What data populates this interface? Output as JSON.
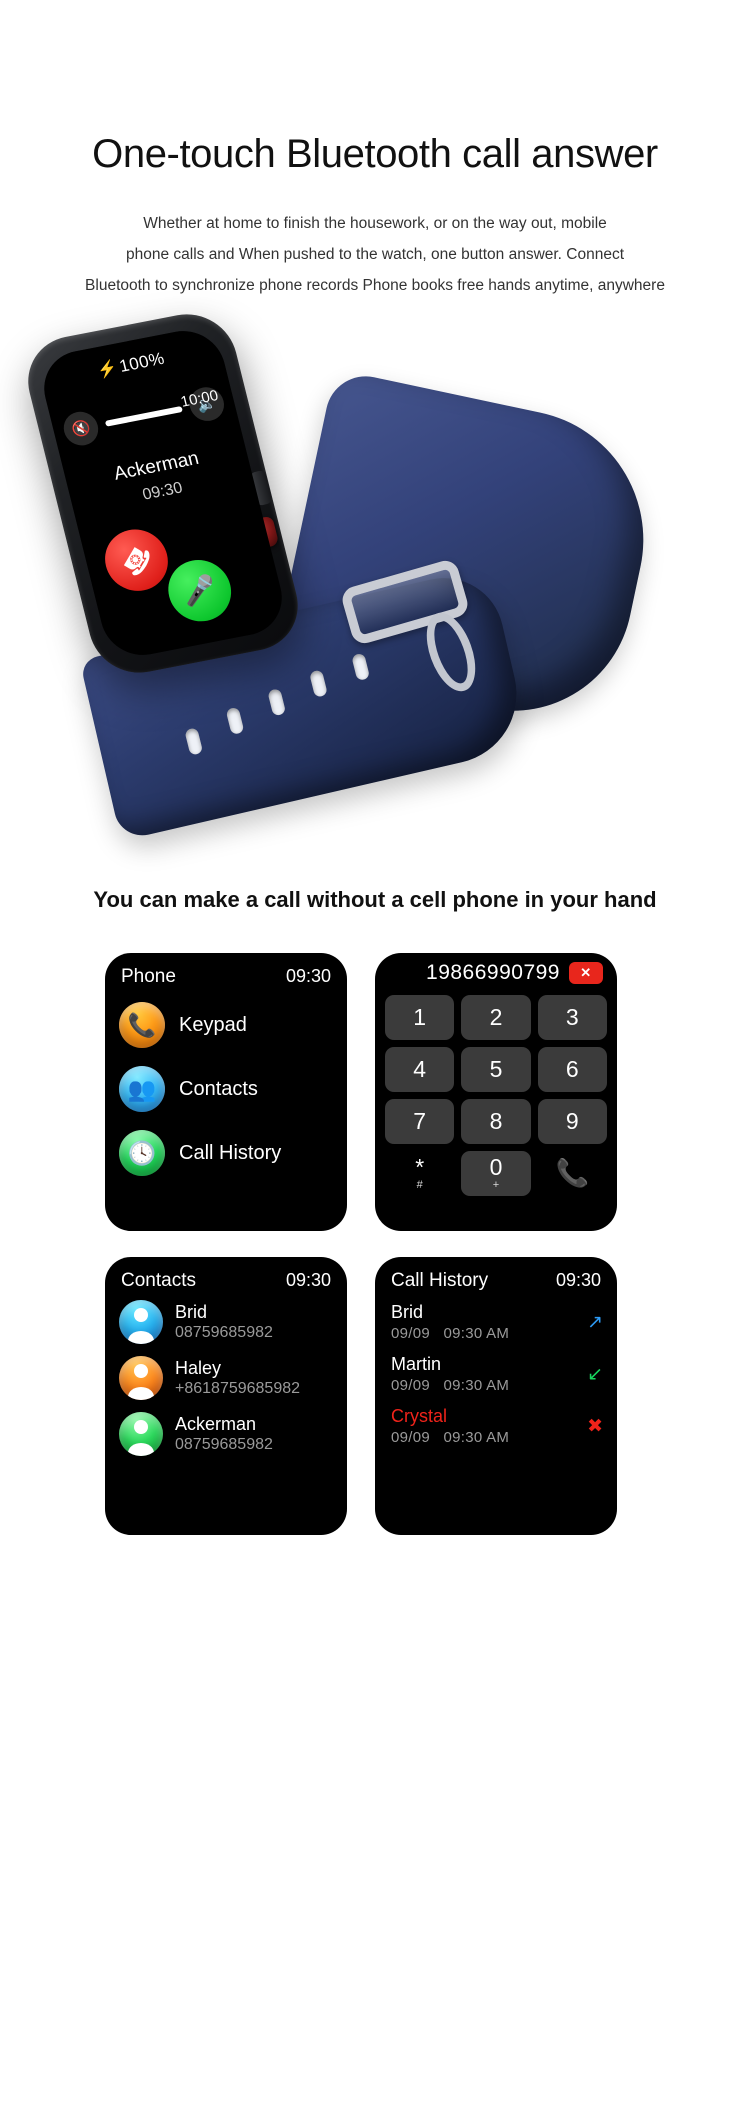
{
  "hero": {
    "title": "One-touch Bluetooth call answer",
    "subtitle_lines": [
      "Whether at home to finish the housework, or on the way out, mobile",
      "phone calls and When pushed to the watch, one button answer. Connect",
      "Bluetooth to synchronize phone records Phone books free hands anytime, anywhere"
    ]
  },
  "watch_screen": {
    "battery": "100%",
    "bolt_icon": "lightning-bolt-icon",
    "time": "10:00",
    "volume_down_icon": "volume-mute-icon",
    "volume_up_icon": "volume-up-icon",
    "caller_name": "Ackerman",
    "caller_time": "09:30",
    "decline_icon": "phone-hangup-icon",
    "accept_icon": "microphone-icon"
  },
  "section2": {
    "title": "You can make a call without a cell phone in your hand"
  },
  "phone_card": {
    "title": "Phone",
    "time": "09:30",
    "items": [
      {
        "label": "Keypad",
        "icon": "phone-ring-icon"
      },
      {
        "label": "Contacts",
        "icon": "contacts-icon"
      },
      {
        "label": "Call History",
        "icon": "clock-icon"
      }
    ]
  },
  "dialer_card": {
    "number": "19866990799",
    "delete_icon": "backspace-delete-icon",
    "delete_glyph": "✕",
    "keys": [
      {
        "main": "1",
        "sub": ""
      },
      {
        "main": "2",
        "sub": ""
      },
      {
        "main": "3",
        "sub": ""
      },
      {
        "main": "4",
        "sub": ""
      },
      {
        "main": "5",
        "sub": ""
      },
      {
        "main": "6",
        "sub": ""
      },
      {
        "main": "7",
        "sub": ""
      },
      {
        "main": "8",
        "sub": ""
      },
      {
        "main": "9",
        "sub": ""
      },
      {
        "main": "*",
        "sub": "#"
      },
      {
        "main": "0",
        "sub": "+"
      }
    ],
    "call_icon": "phone-call-icon"
  },
  "contacts_card": {
    "title": "Contacts",
    "time": "09:30",
    "rows": [
      {
        "name": "Brid",
        "number": "08759685982",
        "avatar_color": "blue"
      },
      {
        "name": "Haley",
        "number": "+8618759685982",
        "avatar_color": "orange"
      },
      {
        "name": "Ackerman",
        "number": "08759685982",
        "avatar_color": "green"
      }
    ]
  },
  "history_card": {
    "title": "Call History",
    "time": "09:30",
    "rows": [
      {
        "name": "Brid",
        "date": "09/09",
        "time": "09:30 AM",
        "type": "outgoing",
        "icon": "call-outgoing-icon",
        "missed": false
      },
      {
        "name": "Martin",
        "date": "09/09",
        "time": "09:30 AM",
        "type": "incoming",
        "icon": "call-incoming-icon",
        "missed": false
      },
      {
        "name": "Crystal",
        "date": "09/09",
        "time": "09:30 AM",
        "type": "missed",
        "icon": "call-missed-icon",
        "missed": true
      }
    ]
  },
  "colors": {
    "accent_green": "#18d84a",
    "accent_red": "#e8261c",
    "accent_blue": "#2e9bf5",
    "strap_blue": "#2c3c6e",
    "card_bg": "#000000"
  }
}
